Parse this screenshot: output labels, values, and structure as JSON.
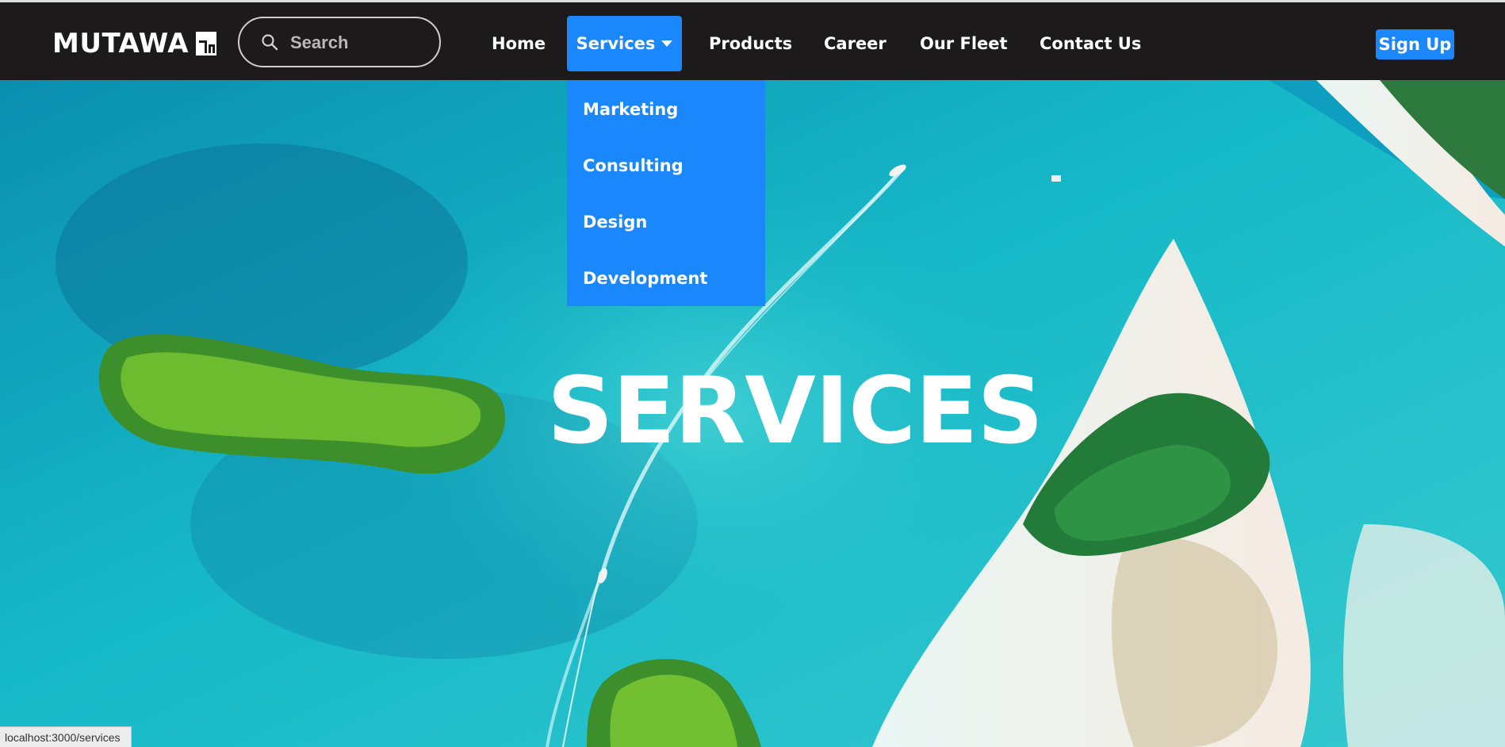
{
  "brand": {
    "name": "MUTAWA",
    "icon": "logo-mark-icon"
  },
  "search": {
    "placeholder": "Search",
    "value": ""
  },
  "nav": {
    "home": "Home",
    "services": "Services",
    "products": "Products",
    "career": "Career",
    "fleet": "Our Fleet",
    "contact": "Contact Us",
    "signup": "Sign Up"
  },
  "dropdown": {
    "items": [
      "Marketing",
      "Consulting",
      "Design",
      "Development"
    ]
  },
  "hero": {
    "title": "SERVICES"
  },
  "status": {
    "url": "localhost:3000/services"
  },
  "colors": {
    "accent": "#1a87fc",
    "navbar": "#1c1a1a"
  }
}
